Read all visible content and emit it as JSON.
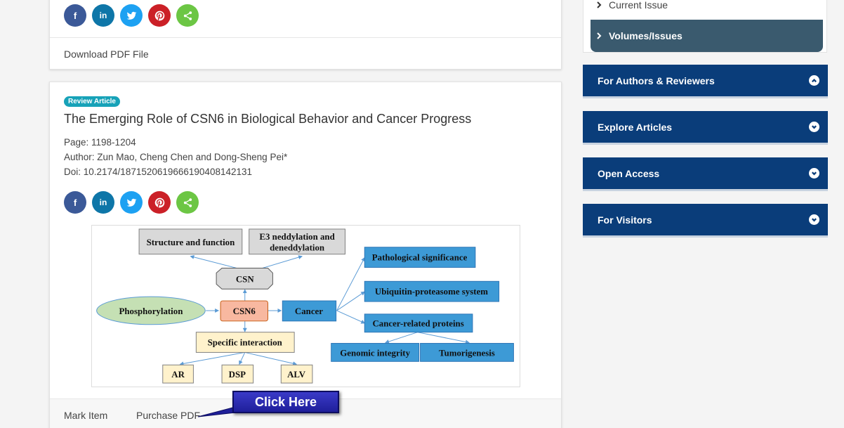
{
  "top_card": {
    "download_label": "Download PDF File"
  },
  "article": {
    "badge": "Review Article",
    "title": "The Emerging Role of CSN6 in Biological Behavior and Cancer Progress",
    "page": "Page: 1198-1204",
    "author": "Author: Zun Mao, Cheng Chen and Dong-Sheng Pei*",
    "doi": "Doi: 10.2174/1871520619666190408142131",
    "mark_item": "Mark Item",
    "purchase_pdf": "Purchase PDF"
  },
  "figure": {
    "structure_and_function": "Structure and function",
    "e3_line1": "E3 neddylation and",
    "e3_line2": "deneddylation",
    "csn": "CSN",
    "phosphorylation": "Phosphorylation",
    "csn6": "CSN6",
    "cancer": "Cancer",
    "pathological_significance": "Pathological significance",
    "ubiquitin_system": "Ubiquitin-proteasome system",
    "cancer_related_proteins": "Cancer-related proteins",
    "genomic_integrity": "Genomic integrity",
    "tumorigenesis": "Tumorigenesis",
    "specific_interaction": "Specific interaction",
    "ar": "AR",
    "dsp": "DSP",
    "alv": "ALV"
  },
  "callout": {
    "label": "Click Here"
  },
  "sidebar": {
    "current_issue": "Current Issue",
    "volumes_issues": "Volumes/Issues",
    "accordions": [
      {
        "label": "For Authors & Reviewers",
        "state": "expanded"
      },
      {
        "label": "Explore Articles",
        "state": "collapsed"
      },
      {
        "label": "Open Access",
        "state": "collapsed"
      },
      {
        "label": "For Visitors",
        "state": "collapsed"
      }
    ]
  },
  "colors": {
    "accordion_bg": "#0a3d7a",
    "active_menu_bg": "#3a5a6e",
    "badge_bg": "#17a2b8",
    "diagram_blue": "#3d9ad6",
    "diagram_gray": "#d9d9d9",
    "diagram_salmon": "#f8b8a0",
    "diagram_green": "#c5e0b4",
    "diagram_cream": "#fff2cc"
  },
  "icons": [
    "facebook-icon",
    "linkedin-icon",
    "twitter-icon",
    "pinterest-icon",
    "share-icon",
    "chevron-right-icon",
    "chevron-up-icon",
    "chevron-down-icon"
  ]
}
